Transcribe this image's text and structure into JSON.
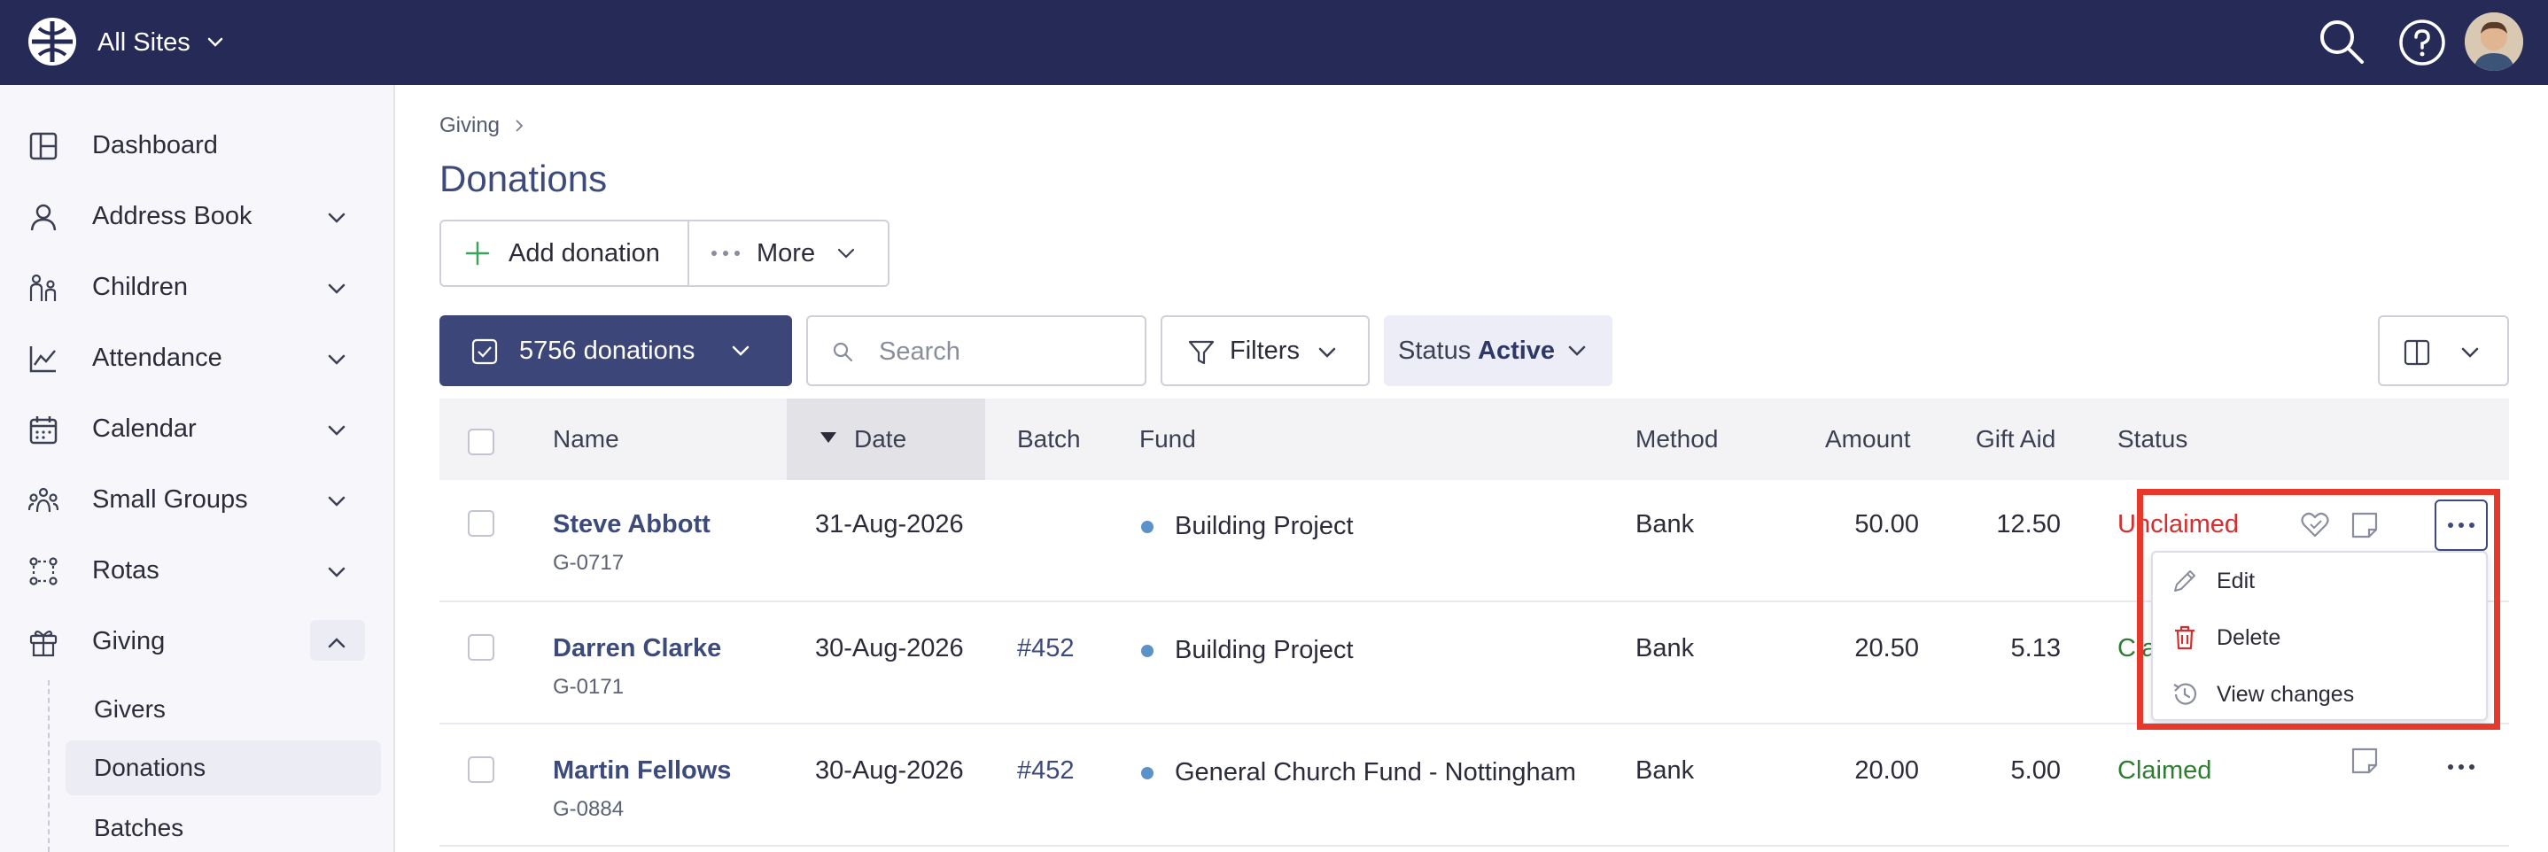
{
  "topbar": {
    "site_label": "All Sites",
    "icons": [
      "logo-icon",
      "chevron-down-icon",
      "search-icon",
      "help-icon",
      "avatar"
    ]
  },
  "sidebar": {
    "items": [
      {
        "label": "Dashboard",
        "icon": "dashboard-icon",
        "expandable": false
      },
      {
        "label": "Address Book",
        "icon": "person-icon",
        "expandable": true
      },
      {
        "label": "Children",
        "icon": "children-icon",
        "expandable": true
      },
      {
        "label": "Attendance",
        "icon": "chart-icon",
        "expandable": true
      },
      {
        "label": "Calendar",
        "icon": "calendar-icon",
        "expandable": true
      },
      {
        "label": "Small Groups",
        "icon": "group-icon",
        "expandable": true
      },
      {
        "label": "Rotas",
        "icon": "rotas-icon",
        "expandable": true
      },
      {
        "label": "Giving",
        "icon": "gift-icon",
        "expandable": true,
        "expanded": true
      }
    ],
    "giving_sub": [
      {
        "label": "Givers",
        "active": false
      },
      {
        "label": "Donations",
        "active": true
      },
      {
        "label": "Batches",
        "active": false
      }
    ]
  },
  "breadcrumb": {
    "parent": "Giving"
  },
  "page": {
    "title": "Donations"
  },
  "actions": {
    "add_label": "Add donation",
    "more_label": "More"
  },
  "toolbar": {
    "count_label": "5756 donations",
    "search_placeholder": "Search",
    "filters_label": "Filters",
    "status_key": "Status",
    "status_value": "Active"
  },
  "table": {
    "headers": {
      "name": "Name",
      "date": "Date",
      "batch": "Batch",
      "fund": "Fund",
      "method": "Method",
      "amount": "Amount",
      "gift_aid": "Gift Aid",
      "status": "Status"
    },
    "sorted_by": "date",
    "rows": [
      {
        "name": "Steve Abbott",
        "code": "G-0717",
        "date": "31-Aug-2026",
        "batch": "",
        "fund": "Building Project",
        "method": "Bank",
        "amount": "50.00",
        "gift_aid": "12.50",
        "status": "Unclaimed"
      },
      {
        "name": "Darren Clarke",
        "code": "G-0171",
        "date": "30-Aug-2026",
        "batch": "#452",
        "fund": "Building Project",
        "method": "Bank",
        "amount": "20.50",
        "gift_aid": "5.13",
        "status": "Claimed"
      },
      {
        "name": "Martin Fellows",
        "code": "G-0884",
        "date": "30-Aug-2026",
        "batch": "#452",
        "fund": "General Church Fund - Nottingham",
        "method": "Bank",
        "amount": "20.00",
        "gift_aid": "5.00",
        "status": "Claimed"
      }
    ]
  },
  "row_menu": {
    "items": [
      {
        "label": "Edit",
        "icon": "pencil-icon"
      },
      {
        "label": "Delete",
        "icon": "trash-icon"
      },
      {
        "label": "View changes",
        "icon": "history-icon"
      }
    ]
  },
  "colors": {
    "topbar": "#262a56",
    "accent": "#3d4678",
    "link": "#3d4a7c",
    "unclaimed": "#d32f2f",
    "claimed": "#2e7d32",
    "highlight": "#e8372b",
    "fund_dot": "#5b93c9"
  }
}
